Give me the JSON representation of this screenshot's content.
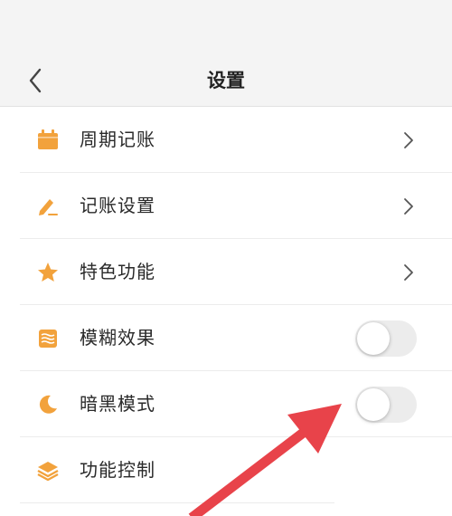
{
  "header": {
    "title": "设置",
    "back_icon": "chevron-left-icon"
  },
  "settings": [
    {
      "key": "periodic-bookkeeping",
      "label": "周期记账",
      "icon": "calendar-icon",
      "control": "chevron"
    },
    {
      "key": "bookkeeping-settings",
      "label": "记账设置",
      "icon": "pen-icon",
      "control": "chevron"
    },
    {
      "key": "special-features",
      "label": "特色功能",
      "icon": "star-icon",
      "control": "chevron"
    },
    {
      "key": "blur-effect",
      "label": "模糊效果",
      "icon": "waves-icon",
      "control": "toggle",
      "enabled": false
    },
    {
      "key": "dark-mode",
      "label": "暗黑模式",
      "icon": "moon-icon",
      "control": "toggle",
      "enabled": false
    },
    {
      "key": "feature-control",
      "label": "功能控制",
      "icon": "layers-icon",
      "control": "none"
    }
  ],
  "colors": {
    "accent": "#f2a23c",
    "annotation_arrow": "#e8434a",
    "toggle_off": "#ececec"
  }
}
